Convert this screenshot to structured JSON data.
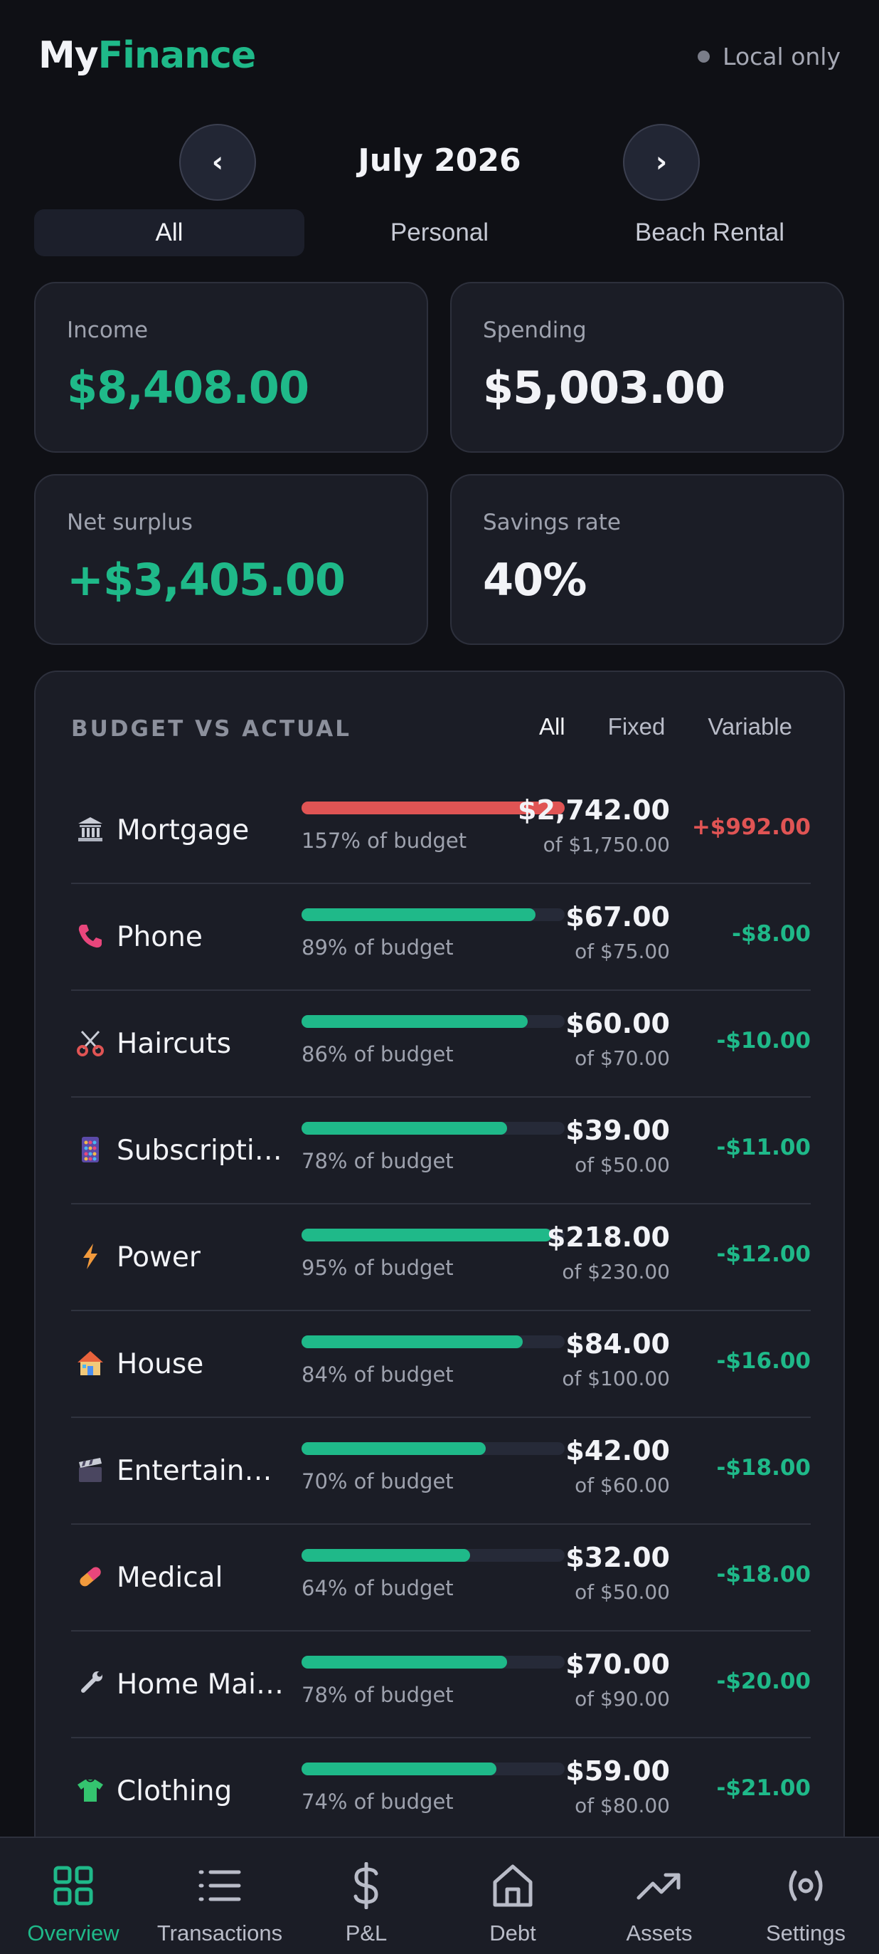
{
  "header": {
    "logo_a": "My",
    "logo_b": "Finance",
    "status": "Local only"
  },
  "month_nav": {
    "prev": "‹",
    "next": "›",
    "title": "July 2026"
  },
  "segments": [
    "All",
    "Personal",
    "Beach Rental"
  ],
  "active_segment": "All",
  "stats": {
    "income": {
      "label": "Income",
      "value": "$8,408.00"
    },
    "spending": {
      "label": "Spending",
      "value": "$5,003.00"
    },
    "net": {
      "label": "Net surplus",
      "value": "+$3,405.00"
    },
    "savings": {
      "label": "Savings rate",
      "value": "40%"
    }
  },
  "budget": {
    "title": "BUDGET VS ACTUAL",
    "filters": [
      "All",
      "Fixed",
      "Variable"
    ],
    "active_filter": "All",
    "rows": [
      {
        "icon": "bank-icon",
        "name": "Mortgage",
        "progress": 1.0,
        "over": true,
        "pct": "157% of budget",
        "actual": "$2,742.00",
        "budget": "of $1,750.00",
        "diff": "+$992.00"
      },
      {
        "icon": "phone-icon",
        "name": "Phone",
        "progress": 0.89,
        "over": false,
        "pct": "89% of budget",
        "actual": "$67.00",
        "budget": "of $75.00",
        "diff": "-$8.00"
      },
      {
        "icon": "scissors-icon",
        "name": "Haircuts",
        "progress": 0.86,
        "over": false,
        "pct": "86% of budget",
        "actual": "$60.00",
        "budget": "of $70.00",
        "diff": "-$10.00"
      },
      {
        "icon": "abacus-icon",
        "name": "Subscriptions",
        "progress": 0.78,
        "over": false,
        "pct": "78% of budget",
        "actual": "$39.00",
        "budget": "of $50.00",
        "diff": "-$11.00"
      },
      {
        "icon": "lightning-icon",
        "name": "Power",
        "progress": 0.95,
        "over": false,
        "pct": "95% of budget",
        "actual": "$218.00",
        "budget": "of $230.00",
        "diff": "-$12.00"
      },
      {
        "icon": "house-icon",
        "name": "House",
        "progress": 0.84,
        "over": false,
        "pct": "84% of budget",
        "actual": "$84.00",
        "budget": "of $100.00",
        "diff": "-$16.00"
      },
      {
        "icon": "clapperboard-icon",
        "name": "Entertainm...",
        "progress": 0.7,
        "over": false,
        "pct": "70% of budget",
        "actual": "$42.00",
        "budget": "of $60.00",
        "diff": "-$18.00"
      },
      {
        "icon": "pill-icon",
        "name": "Medical",
        "progress": 0.64,
        "over": false,
        "pct": "64% of budget",
        "actual": "$32.00",
        "budget": "of $50.00",
        "diff": "-$18.00"
      },
      {
        "icon": "wrench-icon",
        "name": "Home Main...",
        "progress": 0.78,
        "over": false,
        "pct": "78% of budget",
        "actual": "$70.00",
        "budget": "of $90.00",
        "diff": "-$20.00"
      },
      {
        "icon": "tshirt-icon",
        "name": "Clothing",
        "progress": 0.74,
        "over": false,
        "pct": "74% of budget",
        "actual": "$59.00",
        "budget": "of $80.00",
        "diff": "-$21.00"
      }
    ]
  },
  "nav": {
    "tabs": [
      {
        "label": "Overview",
        "icon": "grid-icon"
      },
      {
        "label": "Transactions",
        "icon": "list-icon"
      },
      {
        "label": "P&L",
        "icon": "dollar-icon"
      },
      {
        "label": "Debt",
        "icon": "home-icon"
      },
      {
        "label": "Assets",
        "icon": "trending-up-icon"
      },
      {
        "label": "Settings",
        "icon": "settings-icon"
      }
    ],
    "active": "Overview"
  },
  "colors": {
    "accent": "#1fb989",
    "danger": "#e05454",
    "background": "#0f1015",
    "card": "#1b1d26"
  }
}
